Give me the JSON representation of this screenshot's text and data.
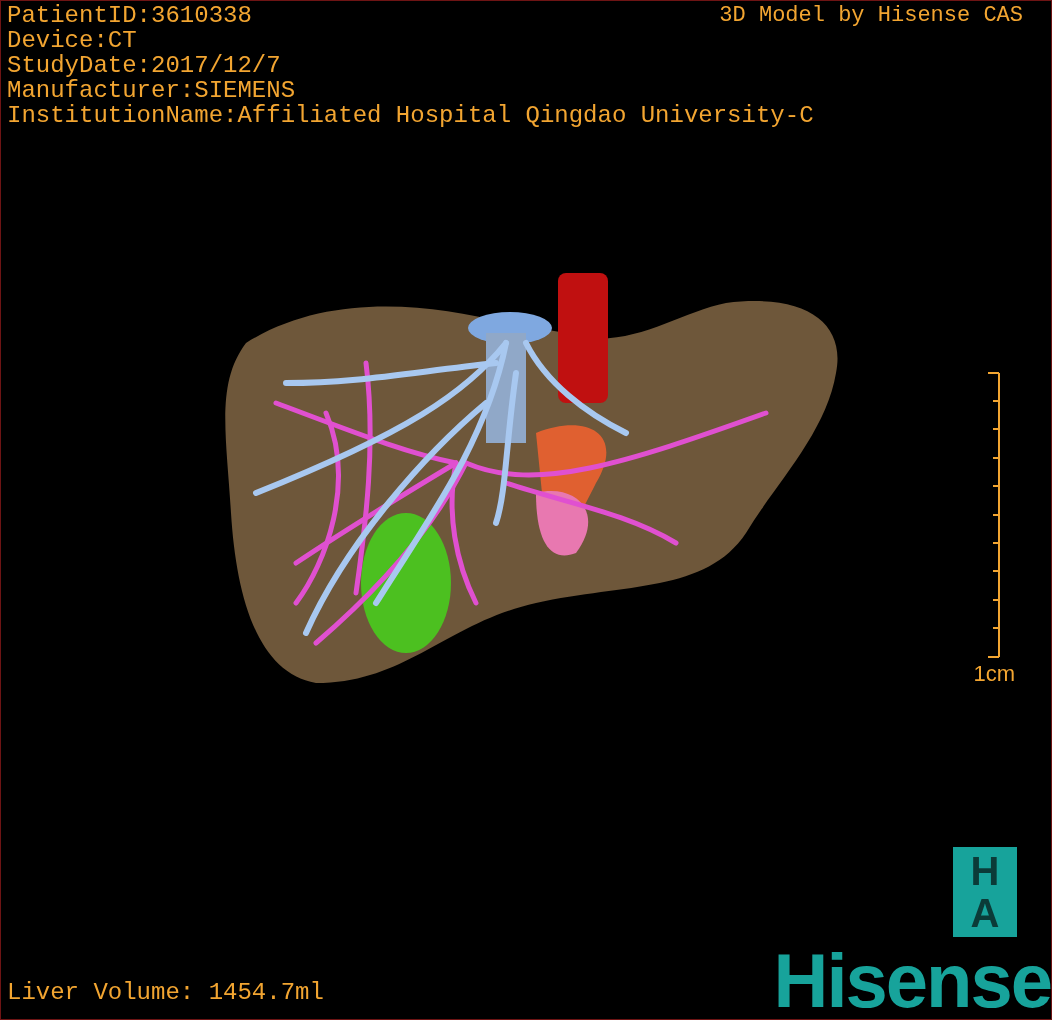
{
  "header": {
    "info_lines": [
      "PatientID:3610338",
      "Device:CT",
      "StudyDate:2017/12/7",
      "Manufacturer:SIEMENS",
      "InstitutionName:Affiliated Hospital Qingdao University-C"
    ],
    "title": "3D Model by Hisense CAS"
  },
  "scale": {
    "label": "1cm"
  },
  "footer": {
    "volume": "Liver Volume: 1454.7ml",
    "logo": {
      "badge_letters": [
        "H",
        "A"
      ],
      "brand": "Hisense"
    }
  }
}
